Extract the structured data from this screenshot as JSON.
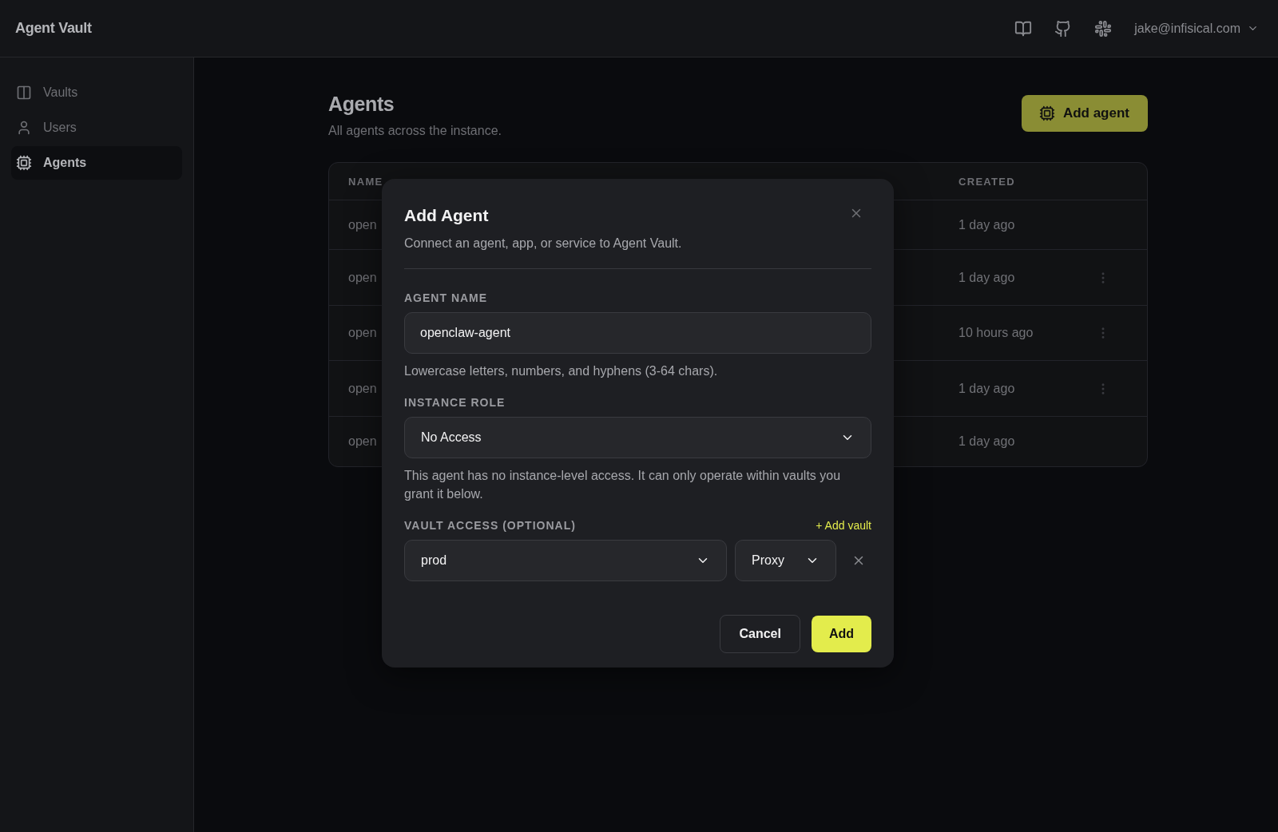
{
  "header": {
    "brand": "Agent Vault",
    "user": "jake@infisical.com"
  },
  "sidebar": {
    "items": [
      {
        "label": "Vaults",
        "selected": false
      },
      {
        "label": "Users",
        "selected": false
      },
      {
        "label": "Agents",
        "selected": true
      }
    ]
  },
  "page": {
    "title": "Agents",
    "subtitle": "All agents across the instance.",
    "add_button": "Add agent"
  },
  "table": {
    "columns": [
      {
        "label": "NAME"
      },
      {
        "label": "CREATED"
      }
    ],
    "rows": [
      {
        "name": "open",
        "created": "1 day ago",
        "actions_visible": false
      },
      {
        "name": "open",
        "created": "1 day ago",
        "actions_visible": true
      },
      {
        "name": "open",
        "created": "10 hours ago",
        "actions_visible": true
      },
      {
        "name": "open",
        "created": "1 day ago",
        "actions_visible": true
      },
      {
        "name": "open",
        "created": "1 day ago",
        "actions_visible": false
      }
    ]
  },
  "dialog": {
    "title": "Add Agent",
    "description": "Connect an agent, app, or service to Agent Vault.",
    "name_label": "AGENT NAME",
    "name_value": "openclaw-agent",
    "name_hint": "Lowercase letters, numbers, and hyphens (3-64 chars).",
    "role_label": "INSTANCE ROLE",
    "role_value": "No Access",
    "role_hint": "This agent has no instance-level access. It can only operate within vaults you grant it below.",
    "vault_label": "VAULT ACCESS (OPTIONAL)",
    "add_vault": "+ Add vault",
    "vault_rows": [
      {
        "vault": "prod",
        "permission": "Proxy"
      }
    ],
    "cancel": "Cancel",
    "submit": "Add"
  }
}
